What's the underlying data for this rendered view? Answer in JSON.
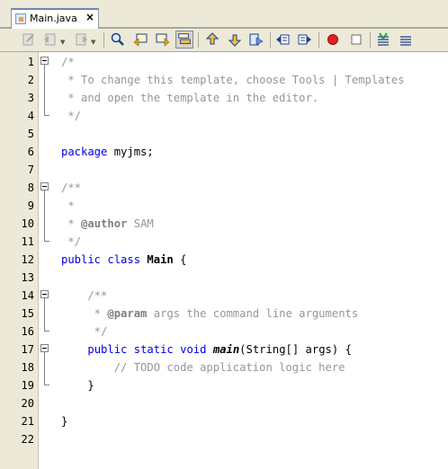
{
  "editor_tab": {
    "title": "Main.java",
    "close_glyph": "×"
  },
  "toolbar": {
    "buttons": [
      "last-edit-icon",
      "back-icon",
      "forward-icon",
      "find-selection-icon",
      "find-previous-icon",
      "find-next-icon",
      "toggle-highlight-search-icon",
      "previous-bookmark-icon",
      "next-bookmark-icon",
      "toggle-bookmark-icon",
      "shift-left-icon",
      "shift-right-icon",
      "start-macro-icon",
      "stop-macro-icon",
      "comment-icon",
      "uncomment-icon"
    ]
  },
  "line_numbers": [
    "1",
    "2",
    "3",
    "4",
    "5",
    "6",
    "7",
    "8",
    "9",
    "10",
    "11",
    "12",
    "13",
    "14",
    "15",
    "16",
    "17",
    "18",
    "19",
    "20",
    "21",
    "22"
  ],
  "code": {
    "l1": "/*",
    "l2": " * To change this template, choose Tools | Templates",
    "l3": " * and open the template in the editor.",
    "l4": " */",
    "l6_kw": "package",
    "l6_rest": " myjms;",
    "l8": "/**",
    "l9": " *",
    "l10_pre": " * ",
    "l10_tag": "@author",
    "l10_rest": " SAM",
    "l11": " */",
    "l12_kw1": "public",
    "l12_kw2": "class",
    "l12_name": "Main",
    "l12_rest": " {",
    "l14": "    /**",
    "l15_pre": "     * ",
    "l15_tag": "@param",
    "l15_rest": " args the command line arguments",
    "l16": "     */",
    "l17_kw1": "public",
    "l17_kw2": "static",
    "l17_kw3": "void",
    "l17_name": "main",
    "l17_rest": "(String[] args) {",
    "l18": "        // TODO code application logic here",
    "l19": "    }",
    "l21": "}"
  }
}
